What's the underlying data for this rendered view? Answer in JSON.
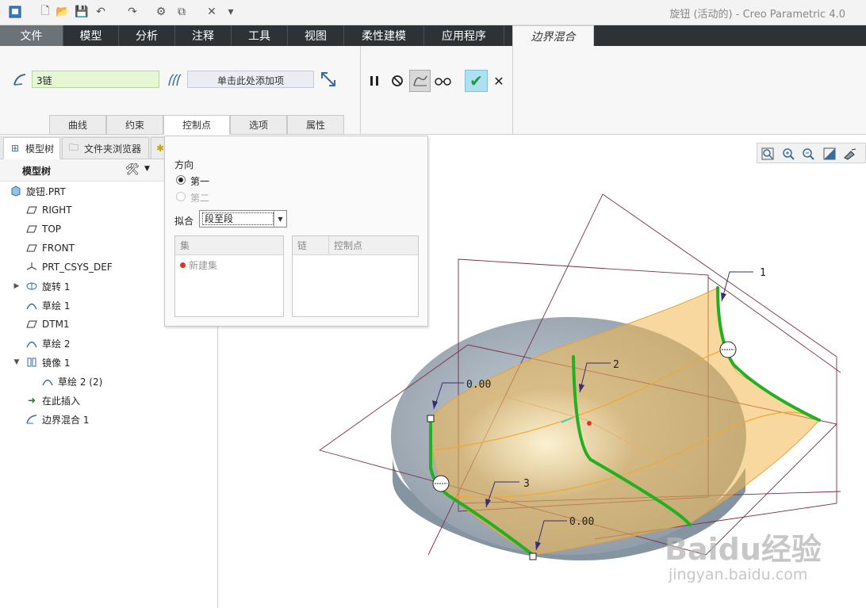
{
  "app_title": "旋钮 (活动的) - Creo Parametric 4.0",
  "ribbon_tabs": [
    "文件",
    "模型",
    "分析",
    "注释",
    "工具",
    "视图",
    "柔性建模",
    "应用程序",
    "边界混合"
  ],
  "chain_field_value": "3链",
  "add_field_placeholder": "单击此处添加项",
  "subtabs": [
    "曲线",
    "约束",
    "控制点",
    "选项",
    "属性"
  ],
  "panel_tabs": [
    "模型树",
    "文件夹浏览器"
  ],
  "tree_header_label": "模型树",
  "tree_items": [
    "旋钮.PRT",
    "RIGHT",
    "TOP",
    "FRONT",
    "PRT_CSYS_DEF",
    "旋转 1",
    "草绘 1",
    "DTM1",
    "草绘 2",
    "镜像 1",
    "草绘 2 (2)",
    "在此插入",
    "边界混合 1"
  ],
  "control_panel": {
    "direction_label": "方向",
    "dir_first": "第一",
    "dir_second": "第二",
    "fit_label": "拟合",
    "fit_value": "段至段",
    "set_header": "集",
    "set_item": "新建集",
    "chain_header": "链",
    "ctrlpt_header": "控制点"
  },
  "model_labels": {
    "label_1": "1",
    "label_2": "2",
    "label_3": "3",
    "dim_a": "0.00",
    "dim_b": "0.00"
  },
  "watermark_main": "Baidu经验",
  "watermark_url": "jingyan.baidu.com",
  "colors": {
    "ribbon_dark": "#2d3236",
    "chain_field": "#e6f7d6",
    "ok_button": "#aee0f2",
    "curve_green": "#22b022",
    "surface_orange": "#f2b84e",
    "solid_grey": "#a9b4be",
    "red_arrow": "#e53228"
  }
}
